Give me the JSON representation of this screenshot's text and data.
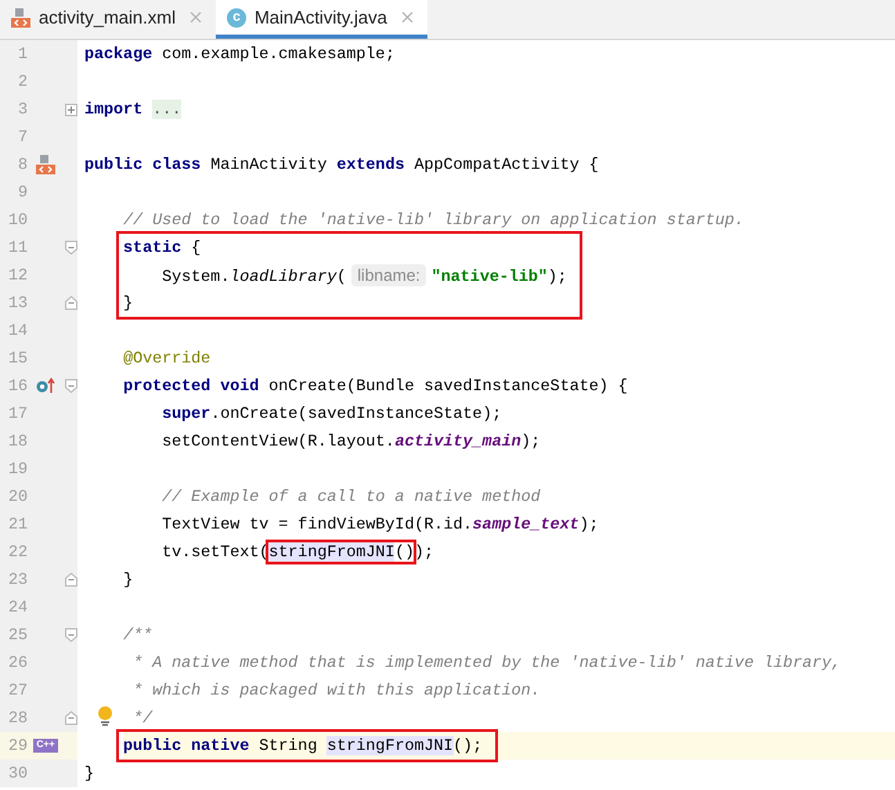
{
  "tabs": [
    {
      "label": "activity_main.xml",
      "kind": "xml",
      "selected": false
    },
    {
      "label": "MainActivity.java",
      "kind": "class",
      "badge": "c",
      "selected": true
    }
  ],
  "code": [
    {
      "kind": "line",
      "lines": [
        {
          "number": "1",
          "current": false,
          "tokens": [
            {
              "kind": "keyword",
              "text": "package"
            },
            {
              "kind": "plain",
              "text": " com.example.cmakesample;"
            }
          ]
        }
      ]
    },
    {
      "kind": "line",
      "lines": [
        {
          "number": "2",
          "current": false
        }
      ]
    },
    {
      "kind": "line",
      "lines": [
        {
          "number": "3",
          "current": false,
          "gutter": [
            {
              "kind": "expand"
            }
          ],
          "tokens": [
            {
              "kind": "keyword",
              "text": "import"
            },
            {
              "kind": "folded",
              "text": " ..."
            }
          ]
        }
      ]
    },
    {
      "kind": "line",
      "lines": [
        {
          "number": "7",
          "current": false
        }
      ]
    },
    {
      "kind": "line",
      "lines": [
        {
          "number": "8",
          "current": false,
          "gutter": [
            {
              "kind": "xml"
            }
          ],
          "tokens": [
            {
              "kind": "keyword",
              "text": "public class"
            },
            {
              "kind": "plain",
              "text": " MainActivity "
            },
            {
              "kind": "keyword",
              "text": "extends"
            },
            {
              "kind": "plain",
              "text": " AppCompatActivity {"
            }
          ]
        }
      ]
    },
    {
      "kind": "line",
      "lines": [
        {
          "number": "9",
          "current": false
        }
      ]
    },
    {
      "kind": "line",
      "lines": [
        {
          "number": "10",
          "current": false,
          "tokens": [
            {
              "kind": "comment",
              "text": "    // Used to load the 'native-lib' library on application startup."
            }
          ]
        }
      ]
    },
    {
      "kind": "box",
      "lines": [
        {
          "number": "11",
          "current": false,
          "gutter": [
            {
              "kind": "fold_start"
            }
          ],
          "tokens": [
            {
              "kind": "keyword",
              "text": "static"
            },
            {
              "kind": "plain",
              "text": " {"
            }
          ]
        },
        {
          "number": "12",
          "current": false,
          "tokens": [
            {
              "kind": "plain",
              "text": "    System."
            },
            {
              "kind": "call",
              "text": "loadLibrary"
            },
            {
              "kind": "plain",
              "text": "("
            },
            {
              "kind": "hint",
              "text": "libname:"
            },
            {
              "kind": "string",
              "text": "\"native-lib\""
            },
            {
              "kind": "plain",
              "text": ");"
            }
          ]
        },
        {
          "number": "13",
          "current": false,
          "gutter": [
            {
              "kind": "fold_end"
            }
          ],
          "tokens": [
            {
              "kind": "plain",
              "text": "}"
            }
          ]
        }
      ]
    },
    {
      "kind": "line",
      "lines": [
        {
          "number": "14",
          "current": false
        }
      ]
    },
    {
      "kind": "line",
      "lines": [
        {
          "number": "15",
          "current": false,
          "tokens": [
            {
              "kind": "annotation",
              "text": "    @Override"
            }
          ]
        }
      ]
    },
    {
      "kind": "line",
      "lines": [
        {
          "number": "16",
          "current": false,
          "gutter": [
            {
              "kind": "override"
            },
            {
              "kind": "fold_start"
            }
          ],
          "tokens": [
            {
              "kind": "keyword",
              "text": "    protected void"
            },
            {
              "kind": "plain",
              "text": " onCreate(Bundle savedInstanceState) {"
            }
          ]
        }
      ]
    },
    {
      "kind": "line",
      "lines": [
        {
          "number": "17",
          "current": false,
          "tokens": [
            {
              "kind": "keyword",
              "text": "        super"
            },
            {
              "kind": "plain",
              "text": ".onCreate(savedInstanceState);"
            }
          ]
        }
      ]
    },
    {
      "kind": "line",
      "lines": [
        {
          "number": "18",
          "current": false,
          "tokens": [
            {
              "kind": "plain",
              "text": "        setContentView(R.layout."
            },
            {
              "kind": "field",
              "text": "activity_main"
            },
            {
              "kind": "plain",
              "text": ");"
            }
          ]
        }
      ]
    },
    {
      "kind": "line",
      "lines": [
        {
          "number": "19",
          "current": false
        }
      ]
    },
    {
      "kind": "line",
      "lines": [
        {
          "number": "20",
          "current": false,
          "tokens": [
            {
              "kind": "comment",
              "text": "        // Example of a call to a native method"
            }
          ]
        }
      ]
    },
    {
      "kind": "line",
      "lines": [
        {
          "number": "21",
          "current": false,
          "tokens": [
            {
              "kind": "plain",
              "text": "        TextView tv = findViewById(R.id."
            },
            {
              "kind": "field",
              "text": "sample_text"
            },
            {
              "kind": "plain",
              "text": ");"
            }
          ]
        }
      ]
    },
    {
      "kind": "line",
      "lines": [
        {
          "number": "22",
          "current": false,
          "tokens": [
            {
              "kind": "plain",
              "text": "        tv.setText("
            },
            {
              "kind": "box",
              "tokens": [
                {
                  "text": "stringFromJNI",
                  "usage": true
                },
                {
                  "text": "()"
                }
              ]
            },
            {
              "kind": "plain",
              "text": ");"
            }
          ]
        }
      ]
    },
    {
      "kind": "line",
      "lines": [
        {
          "number": "23",
          "current": false,
          "gutter": [
            {
              "kind": "fold_end"
            }
          ],
          "tokens": [
            {
              "kind": "plain",
              "text": "    }"
            }
          ]
        }
      ]
    },
    {
      "kind": "line",
      "lines": [
        {
          "number": "24",
          "current": false
        }
      ]
    },
    {
      "kind": "line",
      "lines": [
        {
          "number": "25",
          "current": false,
          "gutter": [
            {
              "kind": "fold_start"
            }
          ],
          "tokens": [
            {
              "kind": "comment",
              "text": "    /**"
            }
          ]
        }
      ]
    },
    {
      "kind": "line",
      "lines": [
        {
          "number": "26",
          "current": false,
          "tokens": [
            {
              "kind": "comment",
              "text": "     * A native method that is implemented by the 'native-lib' native library,"
            }
          ]
        }
      ]
    },
    {
      "kind": "line",
      "lines": [
        {
          "number": "27",
          "current": false,
          "tokens": [
            {
              "kind": "comment",
              "text": "     * which is packaged with this application."
            }
          ]
        }
      ]
    },
    {
      "kind": "line",
      "lines": [
        {
          "number": "28",
          "current": false,
          "gutter": [
            {
              "kind": "fold_end"
            },
            {
              "kind": "bulb"
            }
          ],
          "tokens": [
            {
              "kind": "comment",
              "text": "     */"
            }
          ]
        }
      ]
    },
    {
      "kind": "box",
      "lines": [
        {
          "number": "29",
          "current": true,
          "gutter": [
            {
              "kind": "cpp",
              "label": "C++"
            }
          ],
          "tokens": [
            {
              "kind": "keyword",
              "text": "public native"
            },
            {
              "kind": "plain",
              "text": " String "
            },
            {
              "kind": "plain",
              "text": "stringFromJNI",
              "usage": true
            },
            {
              "kind": "plain",
              "text": "();"
            }
          ]
        }
      ]
    },
    {
      "kind": "line",
      "lines": [
        {
          "number": "30",
          "current": false,
          "tokens": [
            {
              "kind": "plain",
              "text": "}"
            }
          ]
        }
      ]
    }
  ]
}
